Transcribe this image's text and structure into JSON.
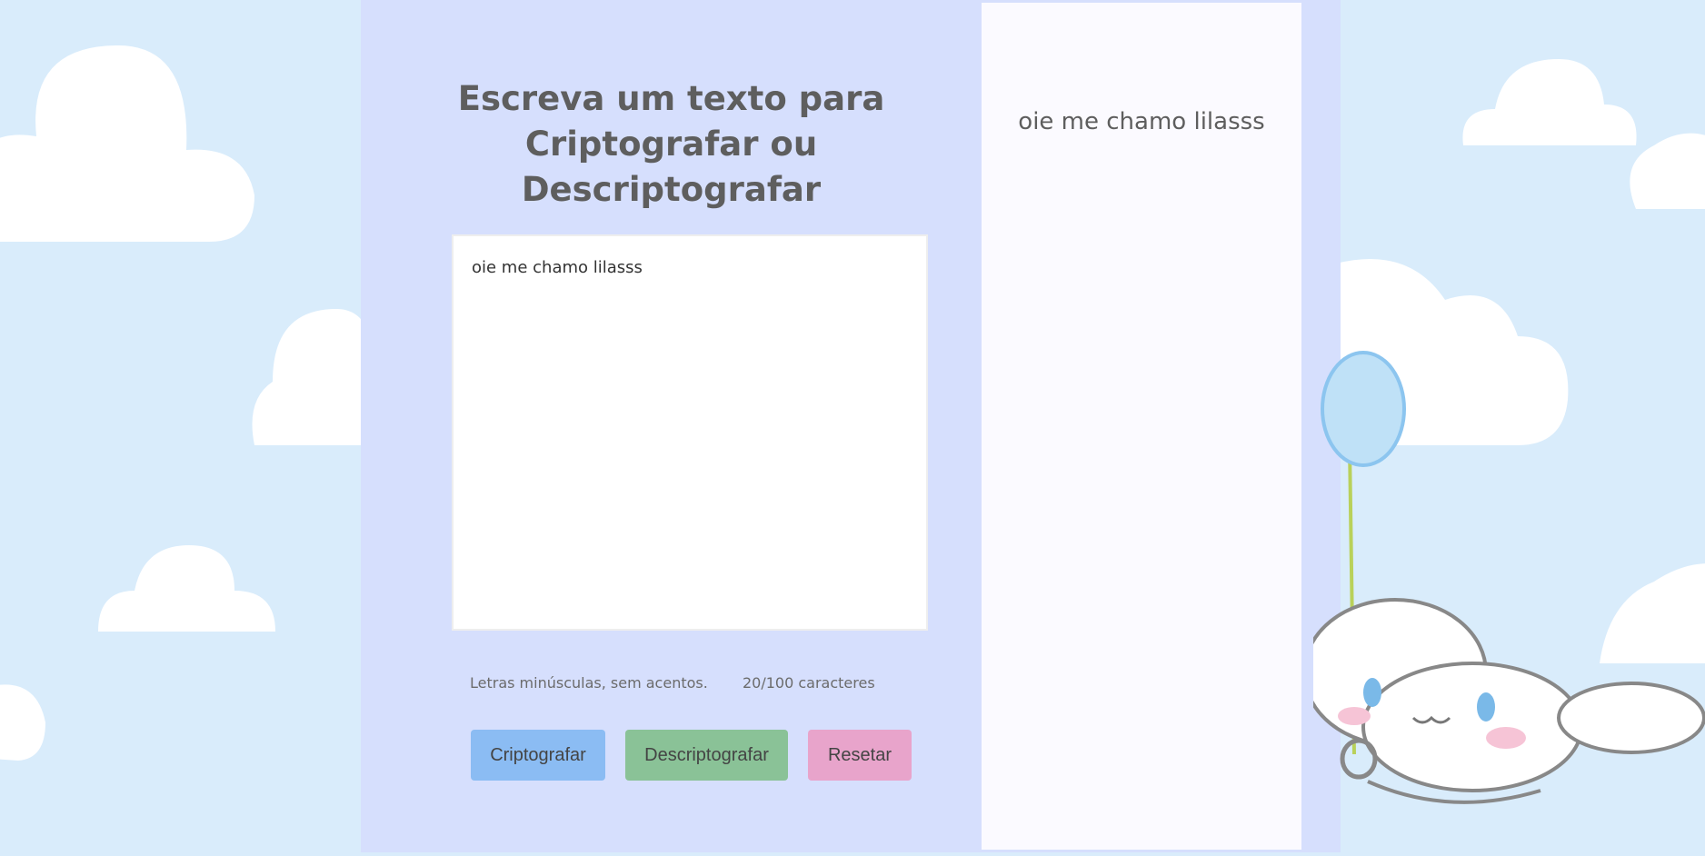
{
  "main": {
    "title_lines": [
      "Escreva um texto para",
      "Criptografar ou",
      "Descriptografar"
    ],
    "input_value": "oie me chamo lilasss",
    "hint": "Letras minúsculas, sem acentos.",
    "counter": "20/100 caracteres",
    "buttons": {
      "encrypt": "Criptografar",
      "decrypt": "Descriptografar",
      "reset": "Resetar"
    },
    "colors": {
      "encrypt": "#8bbcf3",
      "decrypt": "#8ac297",
      "reset": "#e8a4cb",
      "panel": "#d6dffd",
      "output_panel": "#fbfaff",
      "sky": "#d9ecfb"
    }
  },
  "output": {
    "text": "oie me chamo lilasss"
  },
  "decor": {
    "background": "cloud-icon",
    "mascot": "cinnamoroll-balloon-illustration"
  }
}
